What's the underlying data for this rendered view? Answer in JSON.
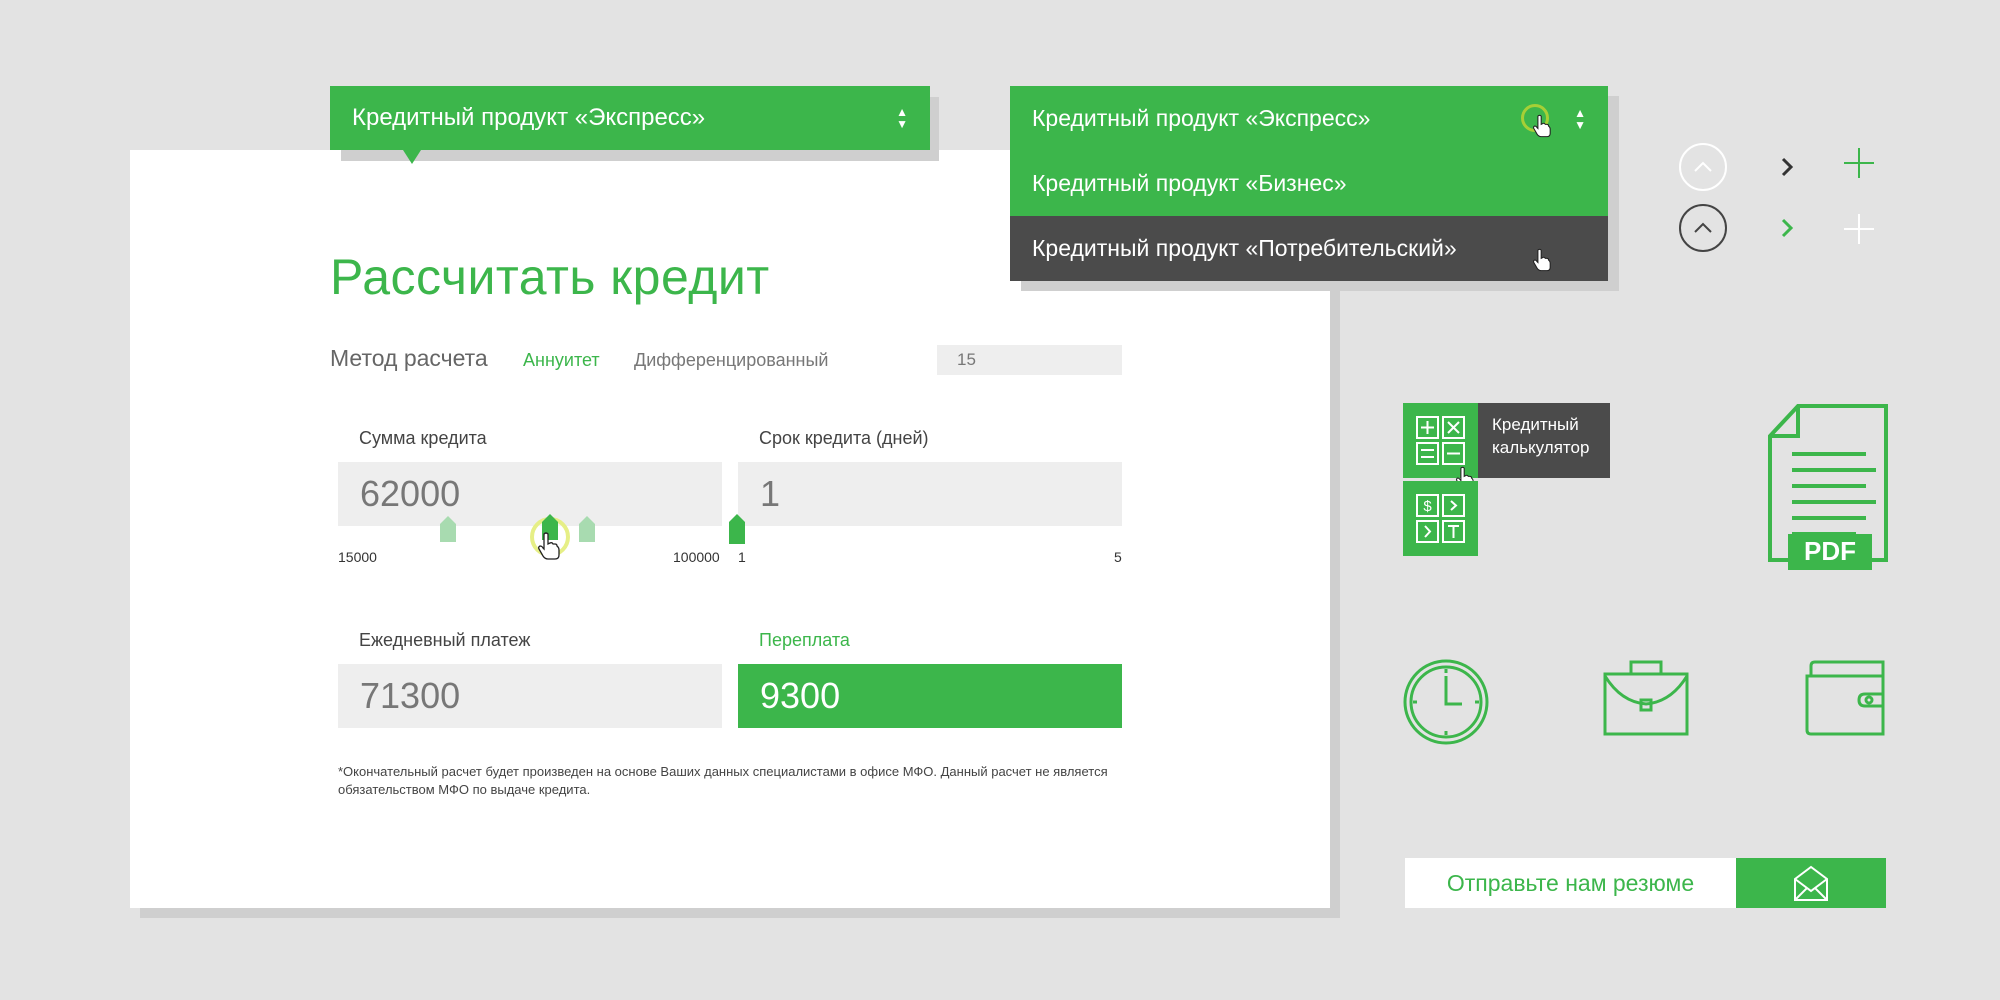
{
  "product_select": {
    "value": "Кредитный продукт «Экспресс»",
    "arrow_up": "▲",
    "arrow_down": "▼"
  },
  "dropdown": {
    "items": [
      "Кредитный продукт «Экспресс»",
      "Кредитный продукт «Бизнес»",
      "Кредитный продукт «Потребительский»"
    ]
  },
  "calculator": {
    "title": "Рассчитать кредит",
    "method_label": "Метод расчета",
    "method_options": [
      "Аннуитет",
      "Дифференцированный"
    ],
    "method_selected": "Аннуитет",
    "small_input_value": "15",
    "amount": {
      "label": "Сумма кредита",
      "value": "62000",
      "min": "15000",
      "max": "100000"
    },
    "term": {
      "label": "Срок кредита (дней)",
      "value": "1",
      "min": "1",
      "max": "5"
    },
    "daily_payment": {
      "label": "Ежедневный платеж",
      "value": "71300"
    },
    "overpayment": {
      "label": "Переплата",
      "value": "9300"
    },
    "note": "*Окончательный расчет будет произведен на основе Ваших данных специалистами в офисе МФО. Данный расчет не является обязательством МФО по выдаче кредита."
  },
  "calc_widget": {
    "tooltip_line1": "Кредитный",
    "tooltip_line2": "калькулятор"
  },
  "pdf_icon": {
    "label": "PDF"
  },
  "resume": {
    "label": "Отправьте нам резюме"
  },
  "colors": {
    "accent": "#3cb64b",
    "dark": "#4b4b4b",
    "background": "#e3e3e3"
  },
  "icons": [
    "chevron-up-icon",
    "chevron-right-icon",
    "plus-icon",
    "calculator-icon",
    "currency-icon",
    "pdf-document-icon",
    "clock-icon",
    "briefcase-icon",
    "wallet-icon",
    "envelope-icon",
    "hand-cursor-icon"
  ]
}
